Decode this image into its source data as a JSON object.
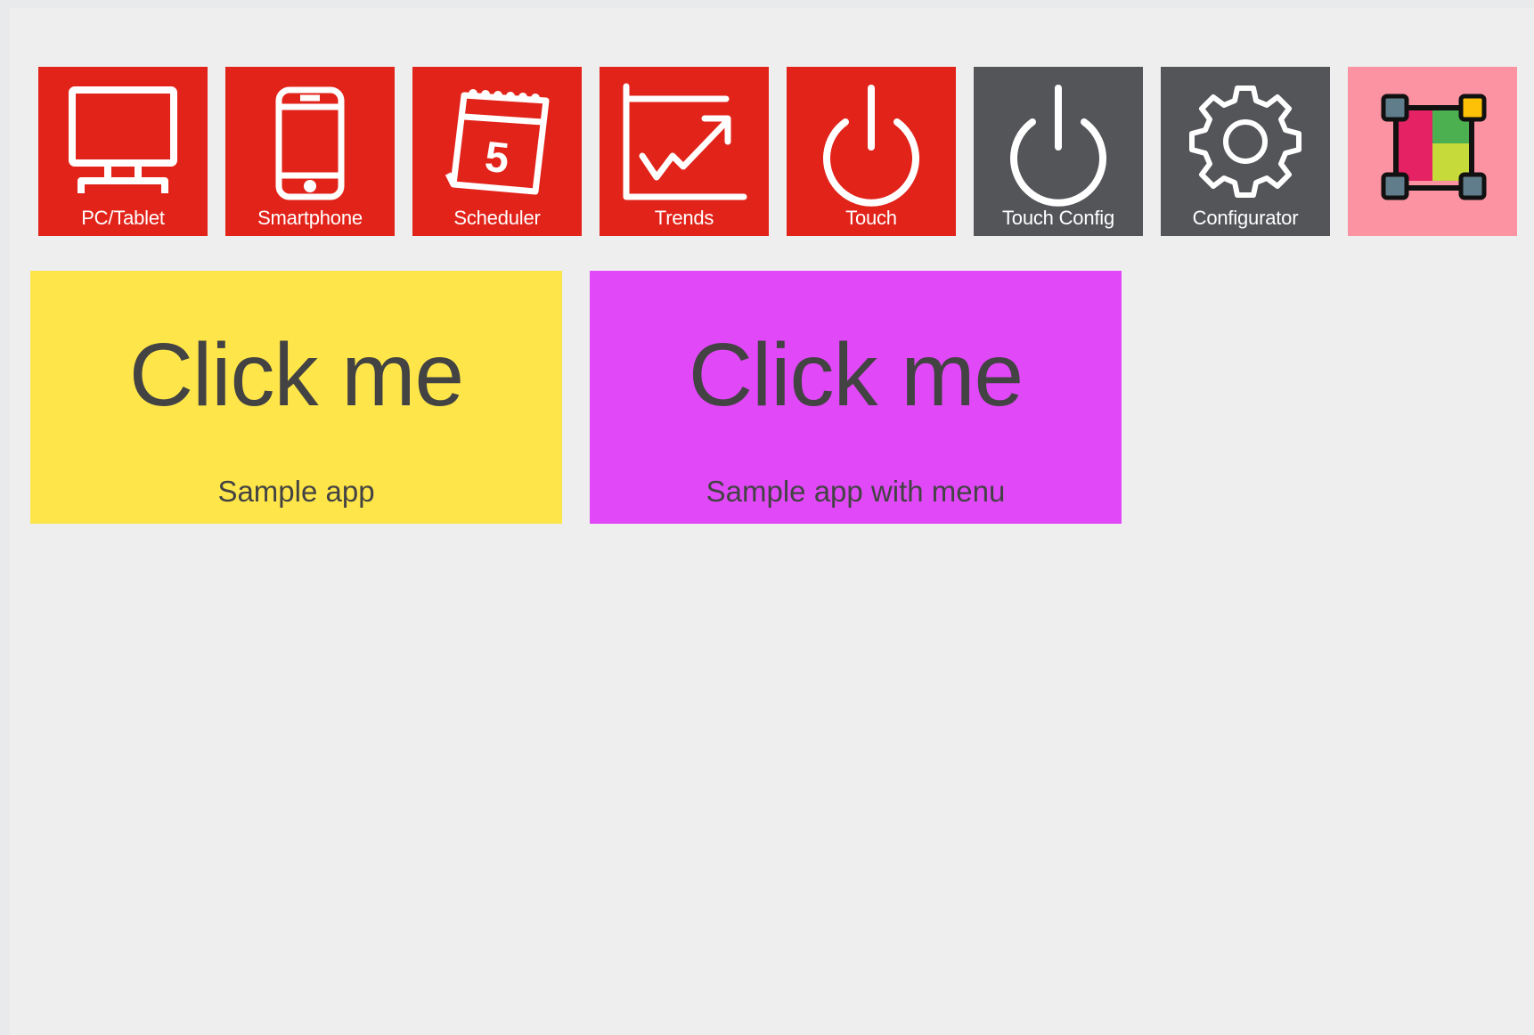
{
  "launcher": {
    "tiles": [
      {
        "label": "PC/Tablet",
        "icon": "monitor-icon",
        "color": "#e2231a"
      },
      {
        "label": "Smartphone",
        "icon": "smartphone-icon",
        "color": "#e2231a"
      },
      {
        "label": "Scheduler",
        "icon": "calendar-icon",
        "color": "#e2231a"
      },
      {
        "label": "Trends",
        "icon": "trend-chart-icon",
        "color": "#e2231a"
      },
      {
        "label": "Touch",
        "icon": "power-icon",
        "color": "#e2231a"
      },
      {
        "label": "Touch Config",
        "icon": "power-icon",
        "color": "#535559"
      },
      {
        "label": "Configurator",
        "icon": "gear-icon",
        "color": "#535559"
      },
      {
        "label": "",
        "icon": "layout-editor-icon",
        "color": "#fc93a2"
      }
    ]
  },
  "apps": [
    {
      "title": "Click me",
      "subtitle": "Sample app",
      "color": "#fee54a"
    },
    {
      "title": "Click me",
      "subtitle": "Sample app with menu",
      "color": "#e148f8"
    }
  ]
}
